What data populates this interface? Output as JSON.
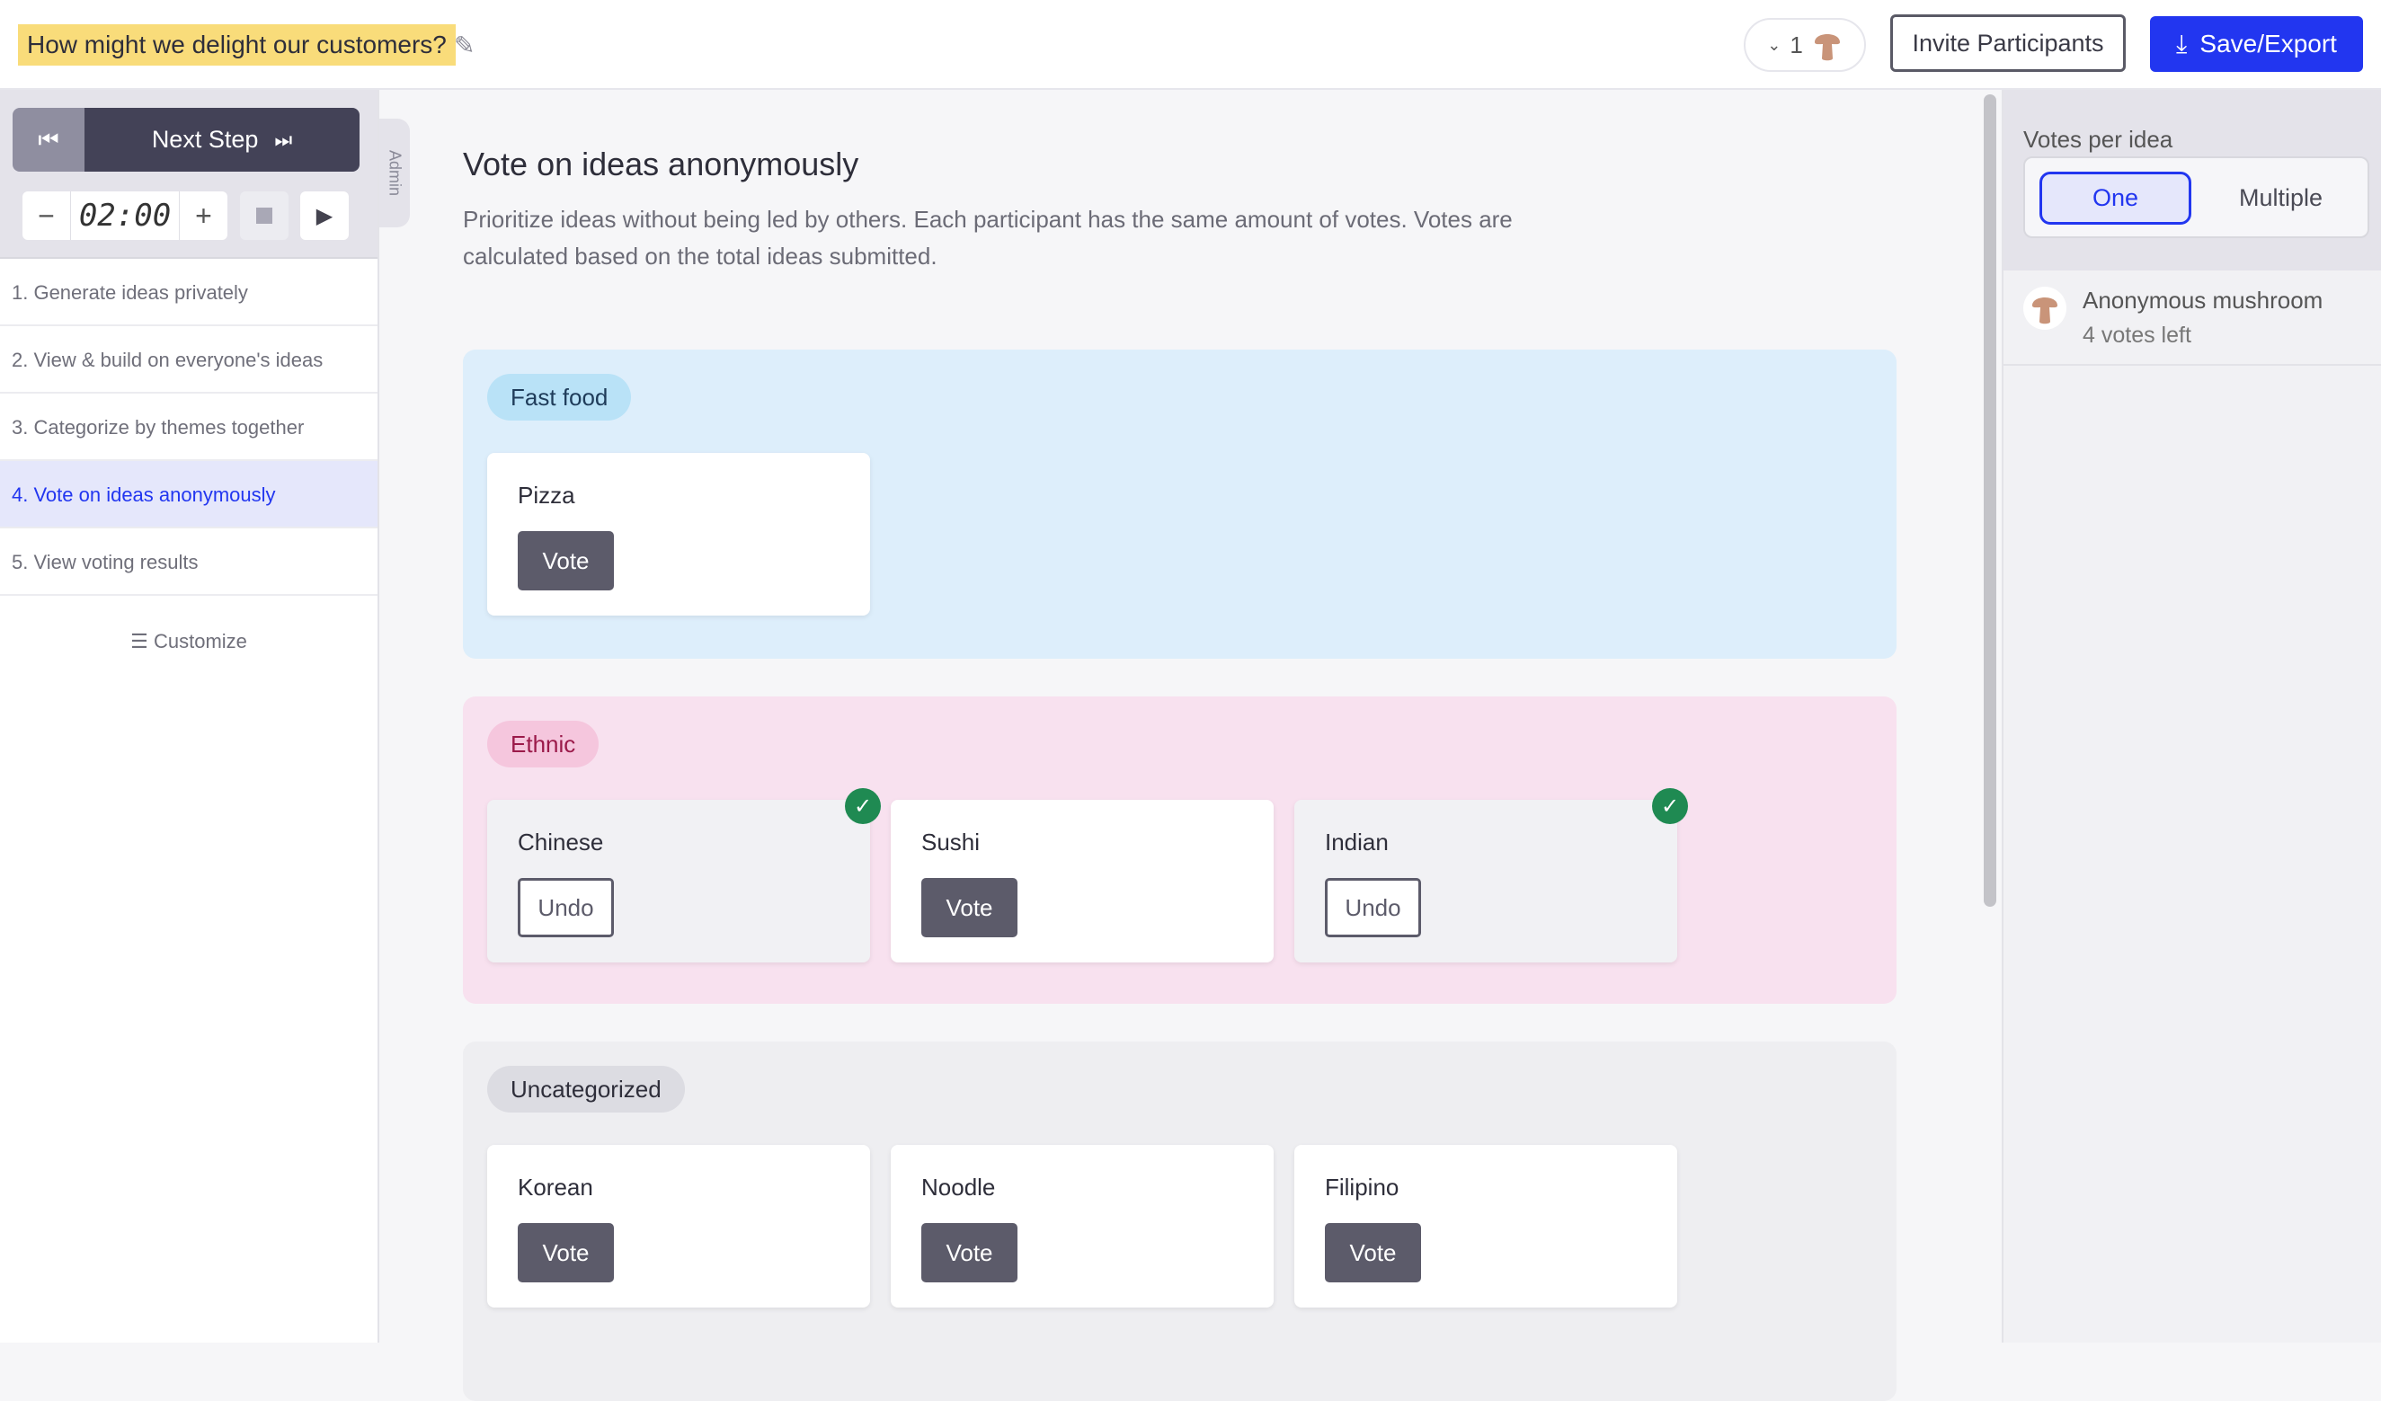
{
  "header": {
    "title": "How might we delight our customers?",
    "participant_count": "1",
    "invite_label": "Invite Participants",
    "save_label": "Save/Export"
  },
  "sidebar": {
    "next_step_label": "Next Step",
    "timer_value": "02:00",
    "admin_label": "Admin",
    "steps": [
      {
        "label": "1. Generate ideas privately"
      },
      {
        "label": "2. View & build on everyone's ideas"
      },
      {
        "label": "3. Categorize by themes together"
      },
      {
        "label": "4. Vote on ideas anonymously",
        "active": true
      },
      {
        "label": "5. View voting results"
      }
    ],
    "customize_label": "Customize"
  },
  "main": {
    "heading": "Vote on ideas anonymously",
    "description": "Prioritize ideas without being led by others. Each participant has the same amount of votes. Votes are calculated based on the total ideas submitted.",
    "groups": [
      {
        "name": "Fast food",
        "ideas": [
          {
            "name": "Pizza",
            "action": "Vote",
            "voted": false
          }
        ]
      },
      {
        "name": "Ethnic",
        "ideas": [
          {
            "name": "Chinese",
            "action": "Undo",
            "voted": true
          },
          {
            "name": "Sushi",
            "action": "Vote",
            "voted": false
          },
          {
            "name": "Indian",
            "action": "Undo",
            "voted": true
          }
        ]
      },
      {
        "name": "Uncategorized",
        "ideas": [
          {
            "name": "Korean",
            "action": "Vote",
            "voted": false
          },
          {
            "name": "Noodle",
            "action": "Vote",
            "voted": false
          },
          {
            "name": "Filipino",
            "action": "Vote",
            "voted": false
          }
        ]
      }
    ]
  },
  "right_panel": {
    "votes_per_idea_label": "Votes per idea",
    "options": [
      "One",
      "Multiple"
    ],
    "selected": "One",
    "user_name": "Anonymous mushroom",
    "votes_left": "4 votes left"
  },
  "colors": {
    "accent": "#2236f0",
    "check": "#1f8a52",
    "fast_food_bg": "#ddeefb",
    "ethnic_bg": "#f8e1ef",
    "uncategorized_bg": "#eeeef1"
  }
}
